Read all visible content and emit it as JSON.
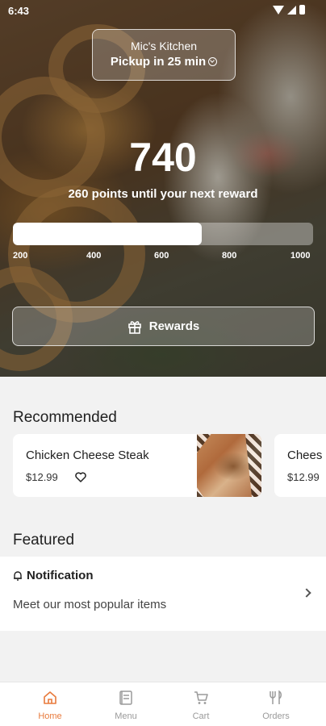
{
  "status_bar": {
    "time": "6:43"
  },
  "store": {
    "name": "Mic's Kitchen",
    "pickup": "Pickup in 25 min"
  },
  "rewards": {
    "points": "740",
    "subtitle": "260 points until your next reward",
    "progress_fraction": 0.63,
    "ticks": [
      "200",
      "400",
      "600",
      "800",
      "1000"
    ],
    "button_label": "Rewards"
  },
  "recommended": {
    "title": "Recommended",
    "items": [
      {
        "name": "Chicken Cheese Steak",
        "price": "$12.99"
      },
      {
        "name": "Chees",
        "price": "$12.99"
      }
    ]
  },
  "featured": {
    "title": "Featured",
    "heading": "Notification",
    "subtitle": "Meet our most popular items"
  },
  "nav": {
    "items": [
      {
        "label": "Home",
        "icon": "home-icon",
        "active": true
      },
      {
        "label": "Menu",
        "icon": "menu-icon",
        "active": false
      },
      {
        "label": "Cart",
        "icon": "cart-icon",
        "active": false
      },
      {
        "label": "Orders",
        "icon": "utensils-icon",
        "active": false
      }
    ]
  },
  "colors": {
    "accent": "#e87a3c",
    "inactive": "#9a9a9a",
    "background": "#f2f2f2"
  }
}
